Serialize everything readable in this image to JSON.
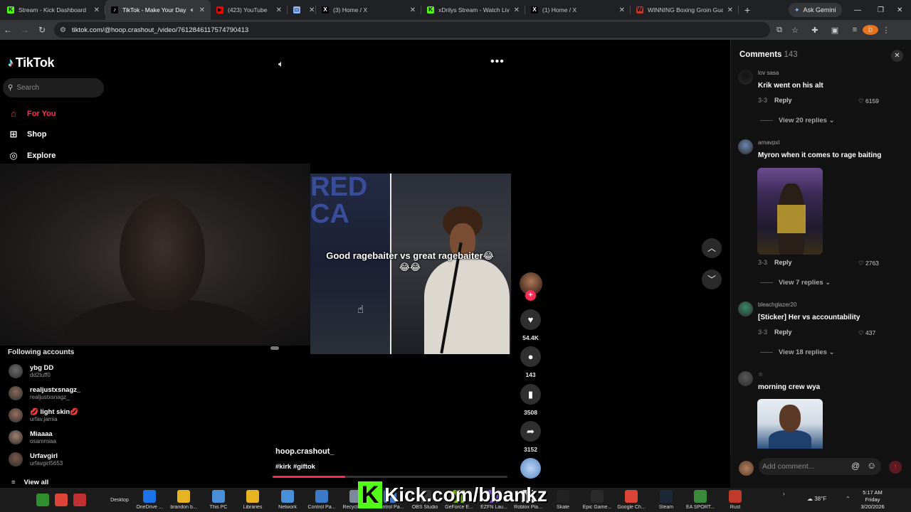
{
  "browser": {
    "tabs": [
      {
        "title": "Stream - Kick Dashboard",
        "fav": "K",
        "fav_color": "#53fc18",
        "active": false
      },
      {
        "title": "TikTok - Make Your Day",
        "fav": "♪",
        "fav_color": "#000000",
        "active": true
      },
      {
        "title": "(423) YouTube",
        "fav": "▶",
        "fav_color": "#ff0000",
        "active": false
      },
      {
        "title": "",
        "fav": "▭",
        "fav_color": "#8ab4f8",
        "active": false
      },
      {
        "title": "(3) Home / X",
        "fav": "X",
        "fav_color": "#000000",
        "active": false
      },
      {
        "title": "xDrilys Stream - Watch Live",
        "fav": "K",
        "fav_color": "#53fc18",
        "active": false
      },
      {
        "title": "(1) Home / X",
        "fav": "X",
        "fav_color": "#000000",
        "active": false
      },
      {
        "title": "WINNING Boxing Groin Gua",
        "fav": "W",
        "fav_color": "#c0392b",
        "active": false
      }
    ],
    "new_tab": "+",
    "ask_gemini": "Ask Gemini",
    "url": "tiktok.com/@hoop.crashout_/video/7612846117574790413"
  },
  "tiktok": {
    "logo": "TikTok",
    "search_placeholder": "Search",
    "nav": [
      {
        "label": "For You",
        "icon": "home-icon",
        "active": true
      },
      {
        "label": "Shop",
        "icon": "shop-icon",
        "active": false
      },
      {
        "label": "Explore",
        "icon": "explore-icon",
        "active": false
      }
    ],
    "following_title": "Following accounts",
    "following": [
      {
        "name": "ybg DD",
        "handle": "dd2tuff0",
        "color": "#6b6b6b"
      },
      {
        "name": "realjustxsnagz_",
        "handle": "realjustxsnagz_",
        "color": "#8a6a5a"
      },
      {
        "name": "💋 light skin💋",
        "handle": "urfav.jamia",
        "color": "#9a7060"
      },
      {
        "name": "Miaaaa",
        "handle": "osammiaa",
        "color": "#a08070"
      },
      {
        "name": "Urfavgirl",
        "handle": "urfavgirl5653",
        "color": "#7a5a4a"
      }
    ],
    "view_all": "View all",
    "video": {
      "caption": "Good ragebaiter vs great ragebaiter😂😂😂",
      "banner_text": "RED CA",
      "author": "hoop.crashout_",
      "tags": "#kirk #giftok",
      "progress": 0.31
    },
    "actions": {
      "likes": "54.4K",
      "comments": "143",
      "saves": "3508",
      "shares": "3152"
    }
  },
  "comments_panel": {
    "title": "Comments",
    "count": "143",
    "items": [
      {
        "user": "lov sasa",
        "text": "Krik went on his alt",
        "date": "3-3",
        "likes": "6159",
        "replies": "View 20 replies",
        "av_color": "#121212"
      },
      {
        "user": "arnavpxl",
        "text": "Myron when it comes to rage baiting",
        "date": "3-3",
        "likes": "2763",
        "replies": "View 7 replies",
        "av_color": "#6a86b0"
      },
      {
        "user": "bleachglazer20",
        "text": "[Sticker] Her vs accountability",
        "date": "3-3",
        "likes": "437",
        "replies": "View 18 replies",
        "av_color": "#3a8a6a"
      },
      {
        "user": "☆",
        "text": "morning crew wya",
        "date": "",
        "likes": "",
        "replies": "",
        "av_color": "#5a5a5a"
      }
    ],
    "reply_label": "Reply",
    "add_placeholder": "Add comment..."
  },
  "taskbar": {
    "items": [
      {
        "label": "",
        "color": "#2f8f2f"
      },
      {
        "label": "",
        "color": "#db4437"
      },
      {
        "label": "",
        "color": "#c03030"
      },
      {
        "label": "Desktop",
        "color": ""
      },
      {
        "label": "OneDrive ...",
        "color": "#1a73e8"
      },
      {
        "label": "brandon b...",
        "color": "#e6b422"
      },
      {
        "label": "This PC",
        "color": "#4a90d9"
      },
      {
        "label": "Libraries",
        "color": "#e6b422"
      },
      {
        "label": "Network",
        "color": "#4a90d9"
      },
      {
        "label": "Control Pa...",
        "color": "#3a7ac9"
      },
      {
        "label": "Recycle Bin",
        "color": "#7a8a9a"
      },
      {
        "label": "Control Pa...",
        "color": "#3a7ac9"
      },
      {
        "label": "OBS Studio",
        "color": "#333333"
      },
      {
        "label": "GeForce E...",
        "color": "#76b900"
      },
      {
        "label": "EZFN Lau...",
        "color": "#7a4ac9"
      },
      {
        "label": "Roblox Pla...",
        "color": "#dddddd"
      },
      {
        "label": "Skate",
        "color": "#222222"
      },
      {
        "label": "Epic Game...",
        "color": "#2a2a2a"
      },
      {
        "label": "Google Ch...",
        "color": "#db4437"
      },
      {
        "label": "Steam",
        "color": "#1b2838"
      },
      {
        "label": "EA SPORT...",
        "color": "#3a8a3a"
      },
      {
        "label": "Rust",
        "color": "#c0392b"
      }
    ],
    "kick_overlay": "Kick.com/bbankz",
    "weather": "38°F",
    "time": "5:17 AM",
    "day": "Friday",
    "date": "3/20/2026"
  }
}
